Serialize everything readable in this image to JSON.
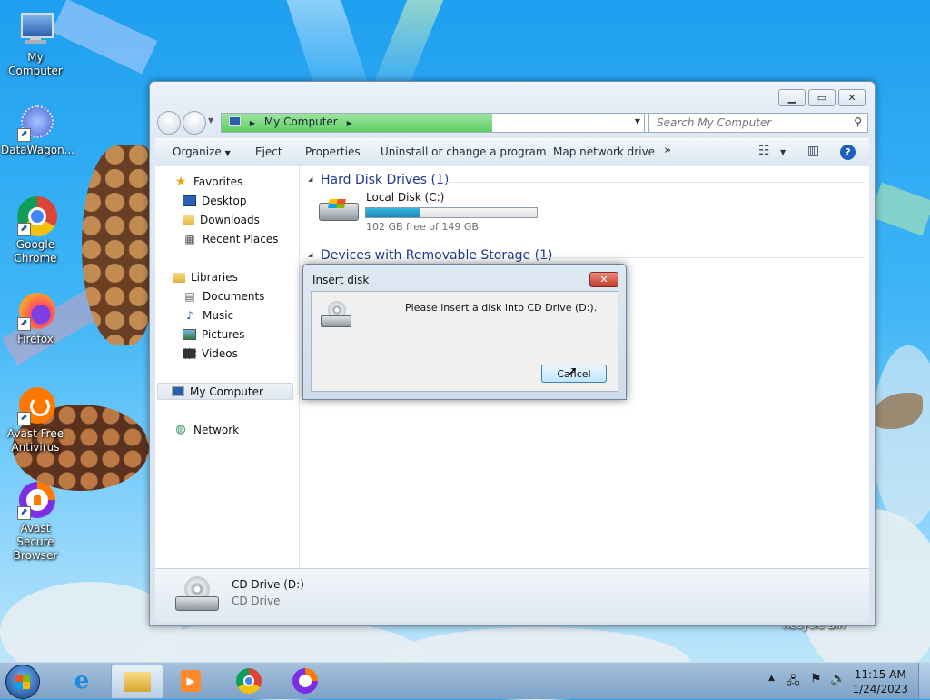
{
  "desktop": {
    "icons": [
      {
        "label": "My Computer"
      },
      {
        "label": "DataWagon..."
      },
      {
        "label": "Google Chrome"
      },
      {
        "label": "Firefox"
      },
      {
        "label": "Avast Free Antivirus"
      },
      {
        "label": "Avast Secure Browser"
      },
      {
        "label": "Recycle Bin"
      }
    ]
  },
  "explorer": {
    "breadcrumb": "My Computer",
    "search_placeholder": "Search My Computer",
    "toolbar": {
      "organize": "Organize",
      "eject": "Eject",
      "properties": "Properties",
      "uninstall": "Uninstall or change a program",
      "map_network": "Map network drive",
      "more": "»"
    },
    "nav": {
      "favorites": "Favorites",
      "desktop": "Desktop",
      "downloads": "Downloads",
      "recent": "Recent Places",
      "libraries": "Libraries",
      "documents": "Documents",
      "music": "Music",
      "pictures": "Pictures",
      "videos": "Videos",
      "computer": "My Computer",
      "network": "Network"
    },
    "groups": {
      "hdd_header": "Hard Disk Drives (1)",
      "removable_header": "Devices with Removable Storage (1)"
    },
    "local_disk": {
      "name": "Local Disk (C:)",
      "free_text": "102 GB free of 149 GB",
      "used_fraction": 0.315
    },
    "details": {
      "name": "CD Drive (D:)",
      "type": "CD Drive"
    }
  },
  "dialog": {
    "title": "Insert disk",
    "close": "✕",
    "message": "Please insert a disk into CD Drive (D:).",
    "cancel": "Cancel"
  },
  "taskbar": {
    "time": "11:15 AM",
    "date": "1/24/2023"
  },
  "colors": {
    "accent": "#1e3a8c",
    "progress": "#5fcf63",
    "disk_bar": "#1b87b8"
  }
}
